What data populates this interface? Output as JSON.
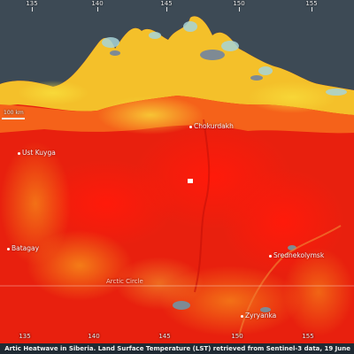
{
  "longitude_ticks_top": [
    "135",
    "140",
    "145",
    "150",
    "155"
  ],
  "longitude_ticks_bottom": [
    "135",
    "140",
    "145",
    "150",
    "155"
  ],
  "scale_bar_label": "100 km",
  "places": {
    "chokurdakh": "Chokurdakh",
    "ust_kuyga": "Ust Kuyga",
    "batagay": "Batagay",
    "srednekolymsk": "Srednekolymsk",
    "zyryanka": "Zyryanka"
  },
  "arctic_circle_label": "Arctic Circle",
  "caption": "Artic Heatwave in Siberia. Land Surface Temperature (LST) retrieved from Sentinel-3 data, 19 June",
  "colors": {
    "sea": "#3d4a55",
    "hot": "#e8200e",
    "warm": "#f56a14",
    "mild": "#f7b21c",
    "cool": "#f4e34a",
    "ice": "#a7d4d8",
    "water": "#7e8a94"
  }
}
